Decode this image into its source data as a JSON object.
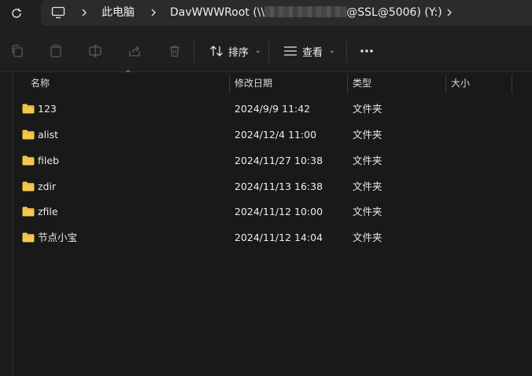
{
  "address": {
    "crumbs": [
      "此电脑",
      "DavWWWRoot (\\\\",
      "@SSL@5006) (Y:)"
    ]
  },
  "toolbar": {
    "sort_label": "排序",
    "view_label": "查看"
  },
  "columns": {
    "name": "名称",
    "modified": "修改日期",
    "type": "类型",
    "size": "大小"
  },
  "files": [
    {
      "name": "123",
      "modified": "2024/9/9 11:42",
      "type": "文件夹"
    },
    {
      "name": "alist",
      "modified": "2024/12/4 11:00",
      "type": "文件夹"
    },
    {
      "name": "fileb",
      "modified": "2024/11/27 10:38",
      "type": "文件夹"
    },
    {
      "name": "zdir",
      "modified": "2024/11/13 16:38",
      "type": "文件夹"
    },
    {
      "name": "zfile",
      "modified": "2024/11/12 10:00",
      "type": "文件夹"
    },
    {
      "name": "节点小宝",
      "modified": "2024/11/12 14:04",
      "type": "文件夹"
    }
  ],
  "icons": {
    "refresh": "refresh-icon",
    "computer": "computer-icon",
    "folder": "folder-icon"
  },
  "colors": {
    "background": "#191919",
    "folder": "#f2c94c"
  }
}
